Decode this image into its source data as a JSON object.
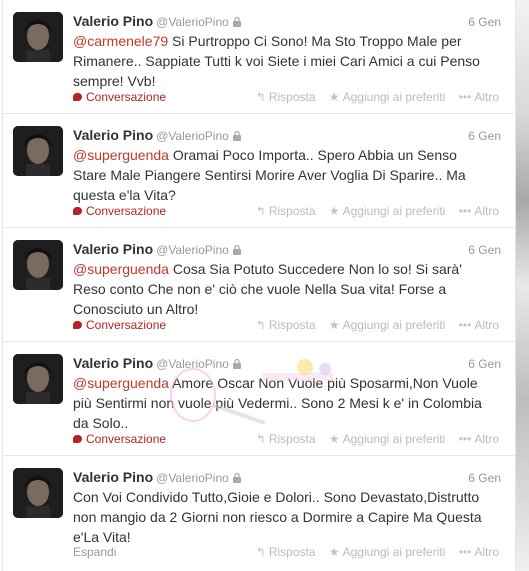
{
  "tweets": [
    {
      "fullname": "Valerio Pino",
      "username": "@ValerioPino",
      "time": "6 Gen",
      "mention": "@carmenele79",
      "body": " Si Purtroppo Ci Sono! Ma Sto Troppo Male per Rimanere.. Sappiate Tutti k voi Siete i miei Cari Amici a cui Penso sempre! Vvb!",
      "footer_link": "Conversazione"
    },
    {
      "fullname": "Valerio Pino",
      "username": "@ValerioPino",
      "time": "6 Gen",
      "mention": "@superguenda",
      "body": " Oramai Poco Importa.. Spero Abbia un Senso Stare Male Piangere Sentirsi Morire Aver Voglia Di Sparire.. Ma questa e'la Vita?",
      "footer_link": "Conversazione"
    },
    {
      "fullname": "Valerio Pino",
      "username": "@ValerioPino",
      "time": "6 Gen",
      "mention": "@superguenda",
      "body": " Cosa Sia Potuto Succedere Non lo so! Si sarà' Reso conto Che non e' ciò che vuole Nella Sua vita! Forse a Conosciuto un Altro!",
      "footer_link": "Conversazione"
    },
    {
      "fullname": "Valerio Pino",
      "username": "@ValerioPino",
      "time": "6 Gen",
      "mention": "@superguenda",
      "body": " Amore Oscar Non Vuole più Sposarmi,Non Vuole più Sentirmi non vuole più Vedermi.. Sono 2 Mesi k e' in Colombia da Solo..",
      "footer_link": "Conversazione"
    },
    {
      "fullname": "Valerio Pino",
      "username": "@ValerioPino",
      "time": "6 Gen",
      "mention": "",
      "body": "Con Voi Condivido Tutto,Gioie e Dolori.. Sono Devastato,Distrutto non mangio da 2 Giorni non riesco a Dormire a Capire Ma Questa e'La Vita!",
      "footer_link": "Espandi"
    }
  ],
  "actions": {
    "reply": "Risposta",
    "favorite": "Aggiungi ai preferiti",
    "more": "Altro"
  },
  "icons": {
    "lock": "lock-icon",
    "reply": "reply-icon",
    "favorite": "star-icon",
    "more": "more-icon",
    "conversation": "speech-bubble-icon"
  },
  "colors": {
    "mention": "#c0392b",
    "conversation": "#b52323",
    "name": "#333333",
    "meta": "#999999"
  }
}
